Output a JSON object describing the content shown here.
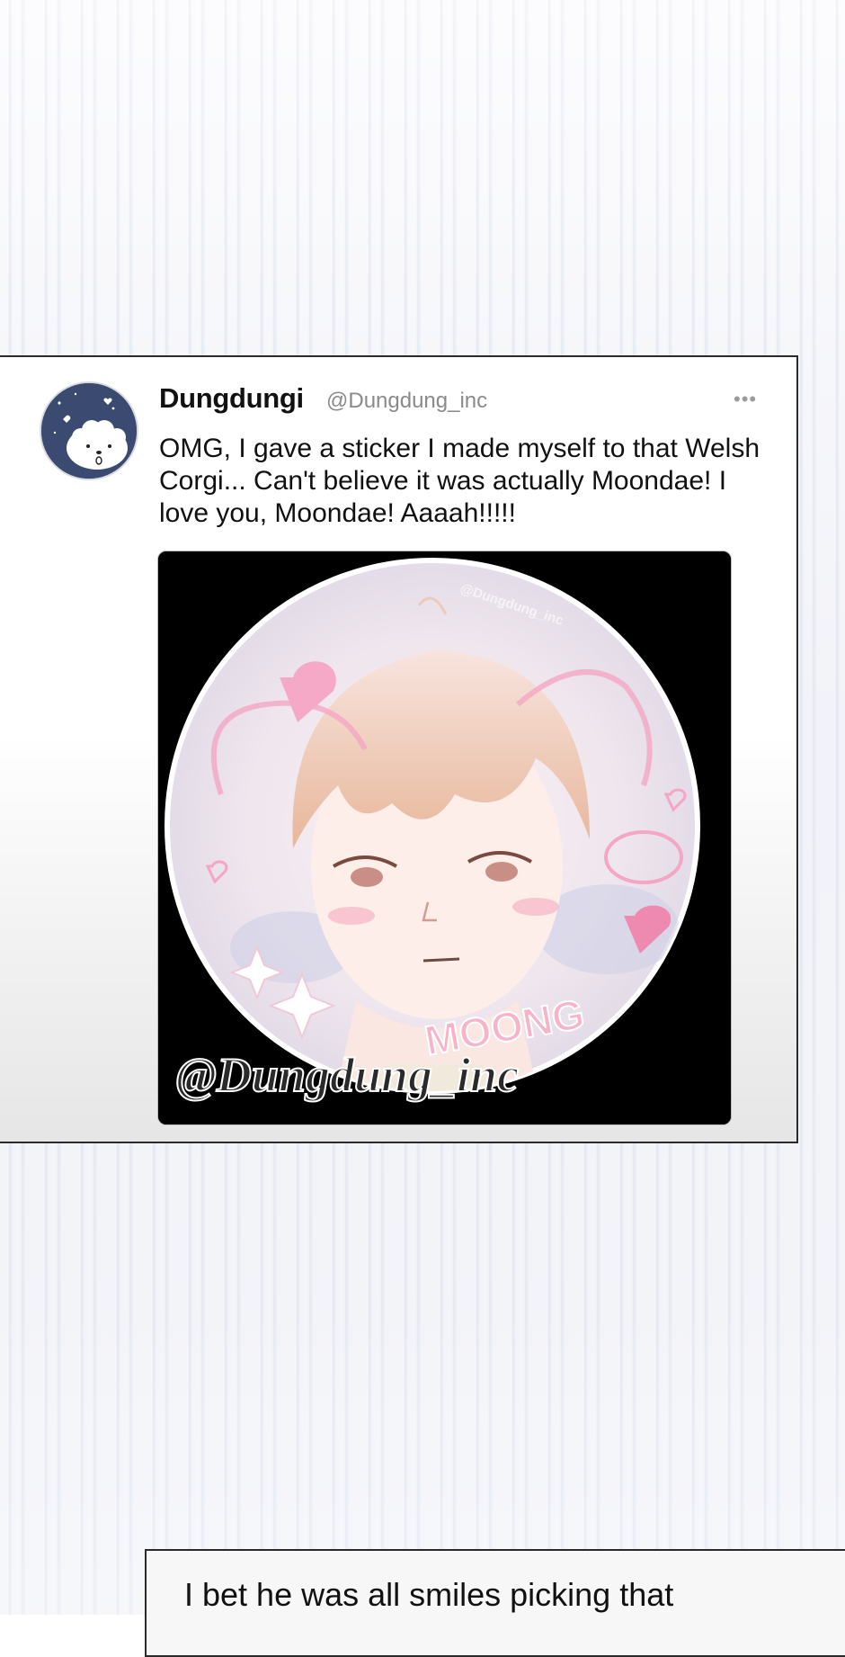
{
  "tweet": {
    "display_name": "Dungdungi",
    "handle": "@Dungdung_inc",
    "more_icon": "•••",
    "text": "OMG, I gave a sticker I made myself to that Welsh Corgi... Can't believe it was actually Moondae! I love you, Moondae! Aaaah!!!!!",
    "photo": {
      "watermark_small": "@Dungdung_inc",
      "watermark_large": "@Dungdung_inc",
      "sticker_label": "MOONG"
    }
  },
  "caption": {
    "text": "I bet he was all smiles picking that"
  },
  "colors": {
    "text": "#111111",
    "handle": "#8a8a8a",
    "avatar_bg": "#3b4a70",
    "sticker_pink": "#f4a6c4"
  }
}
